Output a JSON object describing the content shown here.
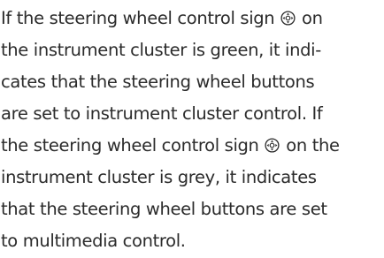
{
  "paragraph": {
    "line1_a": "If the steering wheel control sign ",
    "line1_b": " on",
    "line2": "the instrument cluster is green, it indi-",
    "line3": "cates that the steering wheel buttons",
    "line4": "are set to instrument cluster control. If",
    "line5_a": "the steering wheel control sign ",
    "line5_b": " on the",
    "line6": "instrument cluster is grey, it indicates",
    "line7": "that the steering wheel buttons are set",
    "line8": "to multimedia control."
  },
  "icons": {
    "control_sign": "steering-wheel-control-icon"
  }
}
